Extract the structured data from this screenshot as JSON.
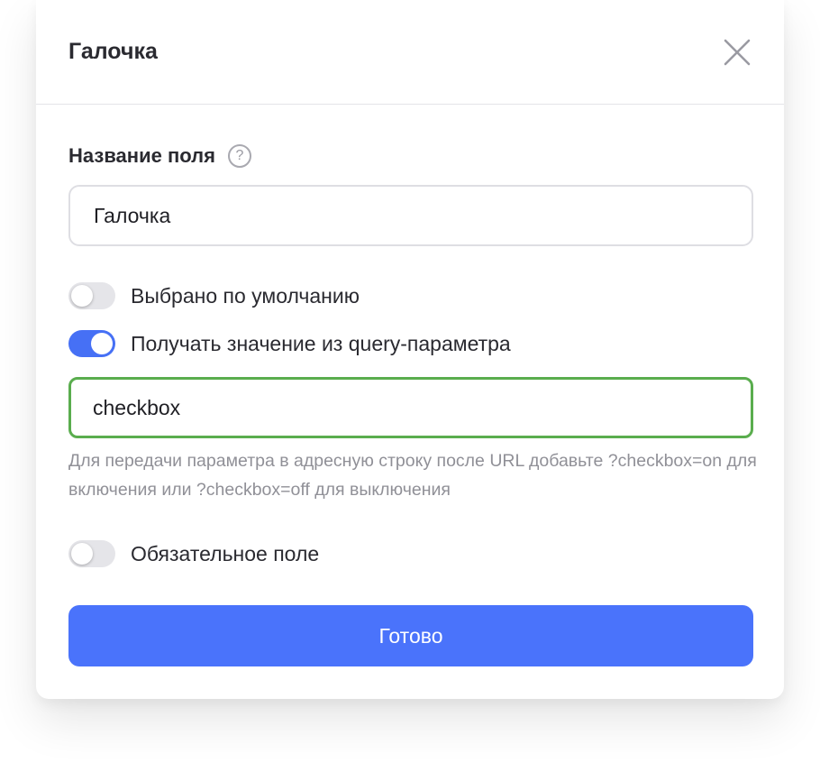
{
  "modal": {
    "title": "Галочка",
    "close_icon": "close-icon"
  },
  "field_name": {
    "label": "Название поля",
    "help_icon": "question-icon",
    "help_glyph": "?",
    "value": "Галочка"
  },
  "toggles": {
    "default_selected": {
      "label": "Выбрано по умолчанию",
      "checked": false
    },
    "query_param": {
      "label": "Получать значение из query-параметра",
      "checked": true
    },
    "required": {
      "label": "Обязательное поле",
      "checked": false
    }
  },
  "query_input": {
    "value": "checkbox"
  },
  "hint": {
    "text": "Для передачи параметра в адресную строку после URL добавьте ?checkbox=on для включения или ?checkbox=off для выключения"
  },
  "done_button": {
    "label": "Готово"
  },
  "colors": {
    "accent": "#4a73fb",
    "toggle_on": "#4670f5",
    "focus_border": "#5aad4e",
    "hint_text": "#909097"
  }
}
